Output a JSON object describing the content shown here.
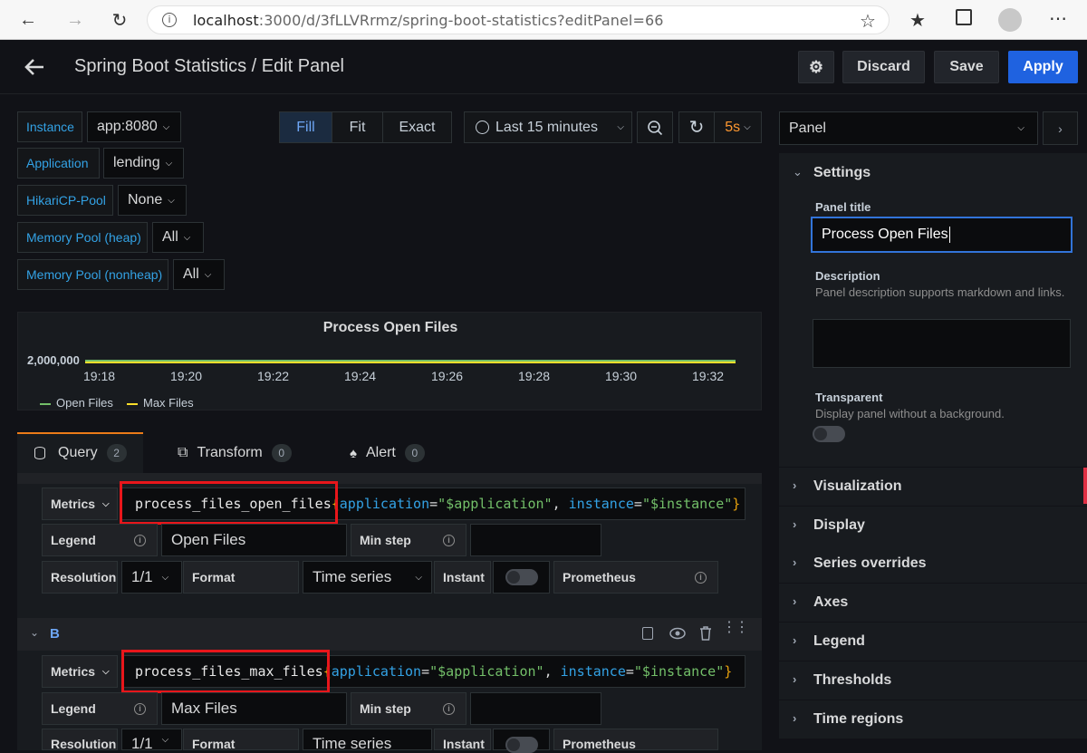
{
  "browser": {
    "url_host": "localhost",
    "url_rest": ":3000/d/3fLLVRrmz/spring-boot-statistics?editPanel=66"
  },
  "header": {
    "title": "Spring Boot Statistics / Edit Panel",
    "discard": "Discard",
    "save": "Save",
    "apply": "Apply"
  },
  "variables": [
    {
      "label": "Instance",
      "value": "app:8080"
    },
    {
      "label": "Application",
      "value": "lending"
    },
    {
      "label": "HikariCP-Pool",
      "value": "None"
    },
    {
      "label": "Memory Pool (heap)",
      "value": "All"
    },
    {
      "label": "Memory Pool (nonheap)",
      "value": "All"
    }
  ],
  "view_modes": [
    "Fill",
    "Fit",
    "Exact"
  ],
  "time_range": "Last 15 minutes",
  "refresh": "5s",
  "preview": {
    "title": "Process Open Files",
    "y_label": "2,000,000",
    "x_ticks": [
      "19:18",
      "19:20",
      "19:22",
      "19:24",
      "19:26",
      "19:28",
      "19:30",
      "19:32"
    ],
    "legend": [
      "Open Files",
      "Max Files"
    ],
    "colors": {
      "open": "#73bf69",
      "max": "#fade2a"
    }
  },
  "tabs": [
    {
      "label": "Query",
      "count": "2"
    },
    {
      "label": "Transform",
      "count": "0"
    },
    {
      "label": "Alert",
      "count": "0"
    }
  ],
  "query_a": {
    "metric": "process_files_open_files",
    "labels": "{application=\"$application\", instance=\"$instance\"}",
    "legend": "Open Files"
  },
  "query_b": {
    "letter": "B",
    "metric": "process_files_max_files",
    "labels": "{application=\"$application\", instance=\"$instance\"}",
    "legend": "Max Files"
  },
  "query_common": {
    "metrics_label": "Metrics",
    "legend_label": "Legend",
    "min_step_label": "Min step",
    "resolution_label": "Resolution",
    "resolution_value": "1/1",
    "format_label": "Format",
    "format_value": "Time series",
    "instant_label": "Instant",
    "datasource": "Prometheus"
  },
  "sidebar": {
    "tab": "Panel",
    "settings": "Settings",
    "panel_title_label": "Panel title",
    "panel_title_value": "Process Open Files",
    "description_label": "Description",
    "description_hint": "Panel description supports markdown and links.",
    "transparent_label": "Transparent",
    "transparent_hint": "Display panel without a background.",
    "sections": [
      "Visualization",
      "Display",
      "Series overrides",
      "Axes",
      "Legend",
      "Thresholds",
      "Time regions"
    ]
  }
}
